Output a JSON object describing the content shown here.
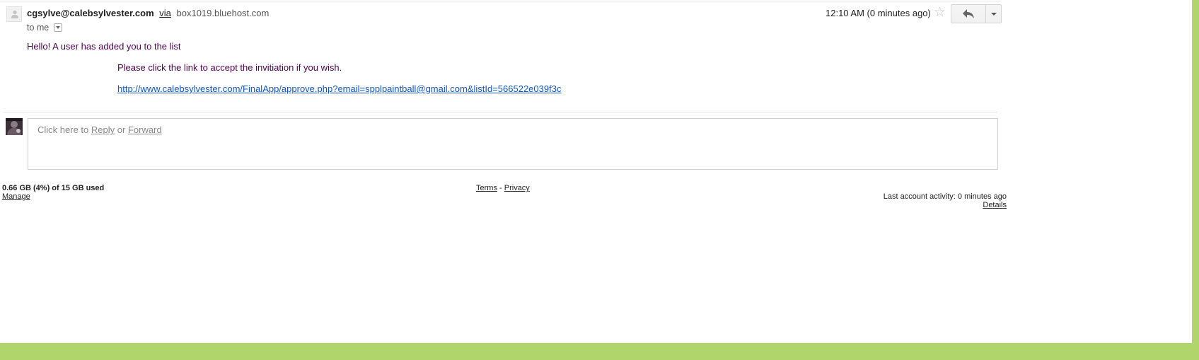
{
  "message": {
    "sender": {
      "address": "cgsylve@calebsylvester.com",
      "via_label": "via",
      "via_host": "box1019.bluehost.com"
    },
    "recipient_label": "to me",
    "timestamp": "12:10 AM (0 minutes ago)",
    "body": {
      "greeting": "Hello! A user has added you to the list",
      "instruction": "Please click the link to accept the invitiation if you wish.",
      "link": "http://www.calebsylvester.com/FinalApp/approve.php?email=spplpaintball@gmail.com&listId=566522e039f3c"
    },
    "colors": {
      "body_text": "#500050",
      "link": "#1155cc"
    }
  },
  "icons": {
    "star": "star-icon",
    "reply": "reply-arrow-icon",
    "more": "chevron-down-icon"
  },
  "reply_box": {
    "prefix": "Click here to",
    "reply_label": "Reply",
    "separator": "or",
    "forward_label": "Forward"
  },
  "footer": {
    "storage": "0.66 GB (4%) of 15 GB used",
    "manage_label": "Manage",
    "terms_label": "Terms",
    "separator": "-",
    "privacy_label": "Privacy",
    "last_activity": "Last account activity: 0 minutes ago",
    "details_label": "Details"
  },
  "theme": {
    "accent_green": "#b0d56a"
  }
}
